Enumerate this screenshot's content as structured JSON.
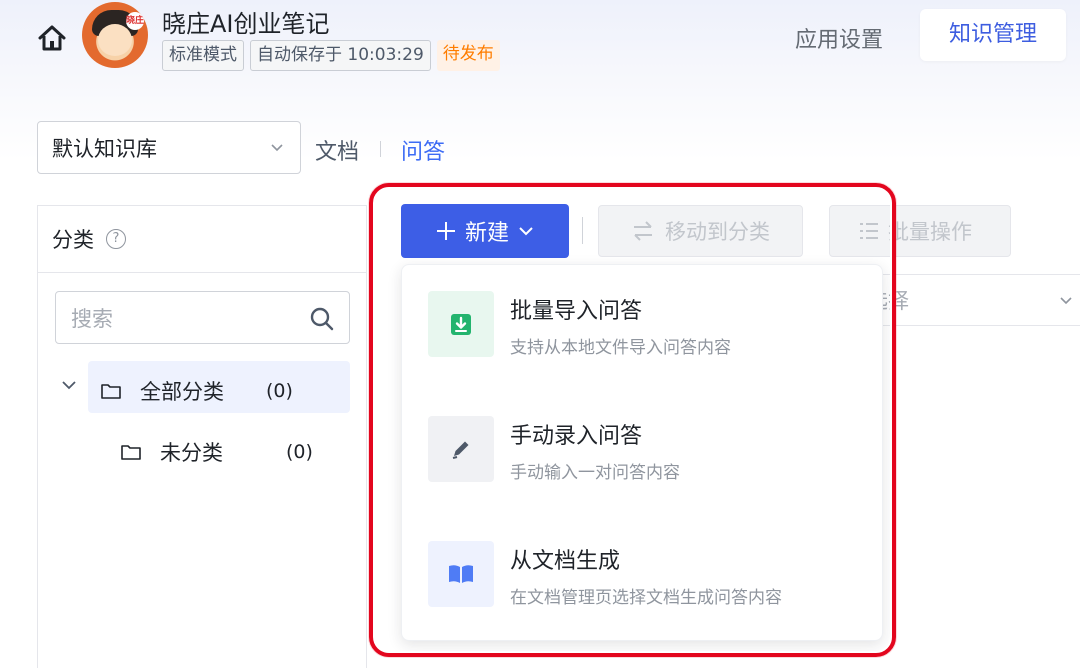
{
  "header": {
    "app_title": "晓庄AI创业笔记",
    "avatar_badge": "晓庄",
    "tags": [
      "标准模式",
      "自动保存于 10:03:29"
    ],
    "status_tag": "待发布",
    "nav_settings": "应用设置",
    "nav_knowledge": "知识管理"
  },
  "knowledge": {
    "selected_base": "默认知识库",
    "tab_doc": "文档",
    "tab_qa": "问答"
  },
  "category": {
    "title": "分类",
    "help": "?",
    "search_placeholder": "搜索",
    "tree": [
      {
        "label": "全部分类",
        "count": "(0)"
      },
      {
        "label": "未分类",
        "count": "(0)"
      }
    ]
  },
  "toolbar": {
    "new_label": "新建",
    "move_label": "移动到分类",
    "batch_label": "批量操作",
    "filter_text": "选择"
  },
  "new_menu": [
    {
      "title": "批量导入问答",
      "desc": "支持从本地文件导入问答内容",
      "icon": "import-icon",
      "icon_bg": "#e8f7ef",
      "icon_color": "#23b46e"
    },
    {
      "title": "手动录入问答",
      "desc": "手动输入一对问答内容",
      "icon": "edit-pencil-icon",
      "icon_bg": "#f0f1f4",
      "icon_color": "#4e5969"
    },
    {
      "title": "从文档生成",
      "desc": "在文档管理页选择文档生成问答内容",
      "icon": "book-icon",
      "icon_bg": "#eef2fe",
      "icon_color": "#4f7cf5"
    }
  ],
  "colors": {
    "primary": "#3d5ee6",
    "link": "#3d6cf5",
    "highlight_border": "#e3061e",
    "status_orange": "#ff7d00"
  }
}
